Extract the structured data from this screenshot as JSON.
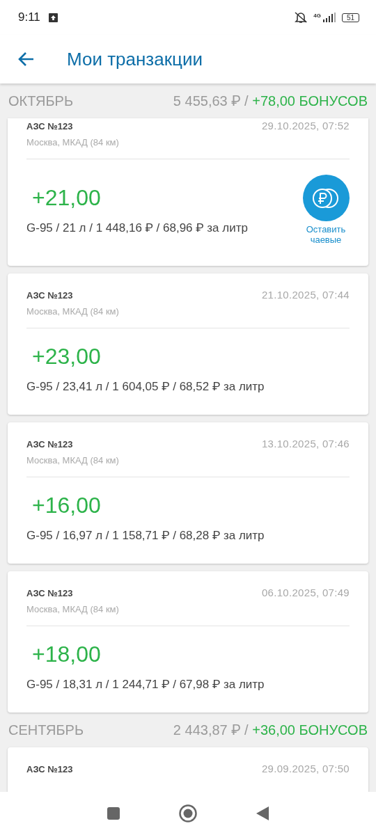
{
  "status_bar": {
    "time": "9:11",
    "network": "4G",
    "battery": "51"
  },
  "app_bar": {
    "title": "Мои транзакции"
  },
  "months": [
    {
      "name": "ОКТЯБРЬ",
      "total": "5 455,63 ₽ /",
      "bonus": "+78,00 БОНУСОВ",
      "transactions": [
        {
          "station": "АЗС №123",
          "date": "29.10.2025, 07:52",
          "address": "Москва, МКАД (84 км)",
          "bonus": "+21,00",
          "details": "G-95 / 21 л / 1 448,16 ₽ / 68,96 ₽ за литр",
          "tip": "Оставить чаевые"
        },
        {
          "station": "АЗС №123",
          "date": "21.10.2025, 07:44",
          "address": "Москва, МКАД (84 км)",
          "bonus": "+23,00",
          "details": "G-95 / 23,41 л / 1 604,05 ₽ / 68,52 ₽ за литр"
        },
        {
          "station": "АЗС №123",
          "date": "13.10.2025, 07:46",
          "address": "Москва, МКАД (84 км)",
          "bonus": "+16,00",
          "details": "G-95 / 16,97 л / 1 158,71 ₽ / 68,28 ₽ за литр"
        },
        {
          "station": "АЗС №123",
          "date": "06.10.2025, 07:49",
          "address": "Москва, МКАД (84 км)",
          "bonus": "+18,00",
          "details": "G-95 / 18,31 л / 1 244,71 ₽ / 67,98 ₽ за литр"
        }
      ]
    },
    {
      "name": "СЕНТЯБРЬ",
      "total": "2 443,87 ₽ /",
      "bonus": "+36,00 БОНУСОВ",
      "transactions": [
        {
          "station": "АЗС №123",
          "date": "29.09.2025, 07:50"
        }
      ]
    }
  ]
}
